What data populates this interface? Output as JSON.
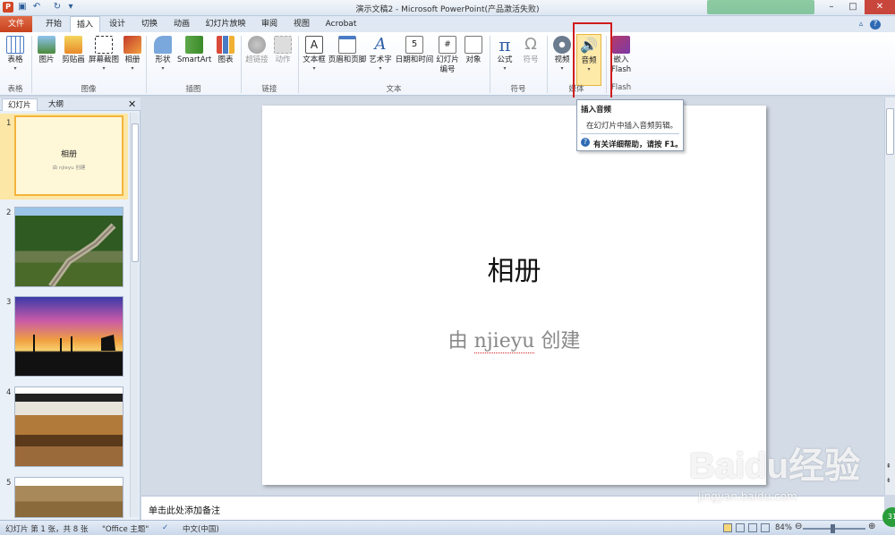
{
  "window": {
    "title": "演示文稿2 - Microsoft PowerPoint(产品激活失败)",
    "quick_access": [
      "save-icon",
      "undo-icon",
      "redo-icon",
      "customize-icon"
    ],
    "controls": [
      "minimize",
      "maximize",
      "close"
    ]
  },
  "tabs": [
    {
      "id": "file",
      "label": "文件"
    },
    {
      "id": "home",
      "label": "开始"
    },
    {
      "id": "insert",
      "label": "插入",
      "active": true
    },
    {
      "id": "design",
      "label": "设计"
    },
    {
      "id": "transitions",
      "label": "切换"
    },
    {
      "id": "animations",
      "label": "动画"
    },
    {
      "id": "slideshow",
      "label": "幻灯片放映"
    },
    {
      "id": "review",
      "label": "审阅"
    },
    {
      "id": "view",
      "label": "视图"
    },
    {
      "id": "acrobat",
      "label": "Acrobat"
    }
  ],
  "ribbon": {
    "buttons": {
      "table": "表格",
      "picture": "图片",
      "clipart": "剪贴画",
      "screenshot": "屏幕截图",
      "album": "相册",
      "shapes": "形状",
      "smartart": "SmartArt",
      "chart": "图表",
      "hyperlink": "超链接",
      "action": "动作",
      "textbox": "文本框",
      "headerfooter": "页眉和页脚",
      "wordart": "艺术字",
      "datetime": "日期和时间",
      "slidenum_1": "幻灯片",
      "slidenum_2": "编号",
      "object": "对象",
      "equation": "公式",
      "symbol": "符号",
      "video": "视频",
      "audio": "音频",
      "flash_1": "嵌入",
      "flash_2": "Flash"
    },
    "groups": {
      "tables": "表格",
      "images": "图像",
      "illustrations": "插图",
      "links": "链接",
      "text": "文本",
      "symbols": "符号",
      "media": "媒体",
      "flash": "Flash"
    }
  },
  "tooltip": {
    "title": "插入音频",
    "description": "在幻灯片中插入音频剪辑。",
    "help": "有关详细帮助，请按 F1。"
  },
  "left_pane": {
    "tabs": {
      "slides": "幻灯片",
      "outline": "大纲"
    },
    "thumbnails": [
      {
        "number": "1",
        "title": "相册",
        "subtitle": "由 njieyu 创建",
        "selected": true
      },
      {
        "number": "2",
        "image": "great-wall"
      },
      {
        "number": "3",
        "image": "sunset-oilfield"
      },
      {
        "number": "4",
        "image": "waterfall-canyon"
      },
      {
        "number": "5",
        "image": "desert-landscape"
      }
    ]
  },
  "slide": {
    "title": "相册",
    "subtitle_pre": "由 ",
    "subtitle_name": "njieyu",
    "subtitle_post": " 创建"
  },
  "notes": {
    "placeholder": "单击此处添加备注"
  },
  "status": {
    "slide_info": "幻灯片 第 1 张，共 8 张",
    "theme": "\"Office 主题\"",
    "language": "中文(中国)",
    "zoom": "84%",
    "zoom_fraction": 0.84
  },
  "watermark": {
    "brand": "Baidu经验",
    "url": "jingyan.baidu.com"
  },
  "colors": {
    "accent_file_tab": "#c7421e",
    "highlight_box": "#d01c1c",
    "selection": "#f2b43c"
  }
}
